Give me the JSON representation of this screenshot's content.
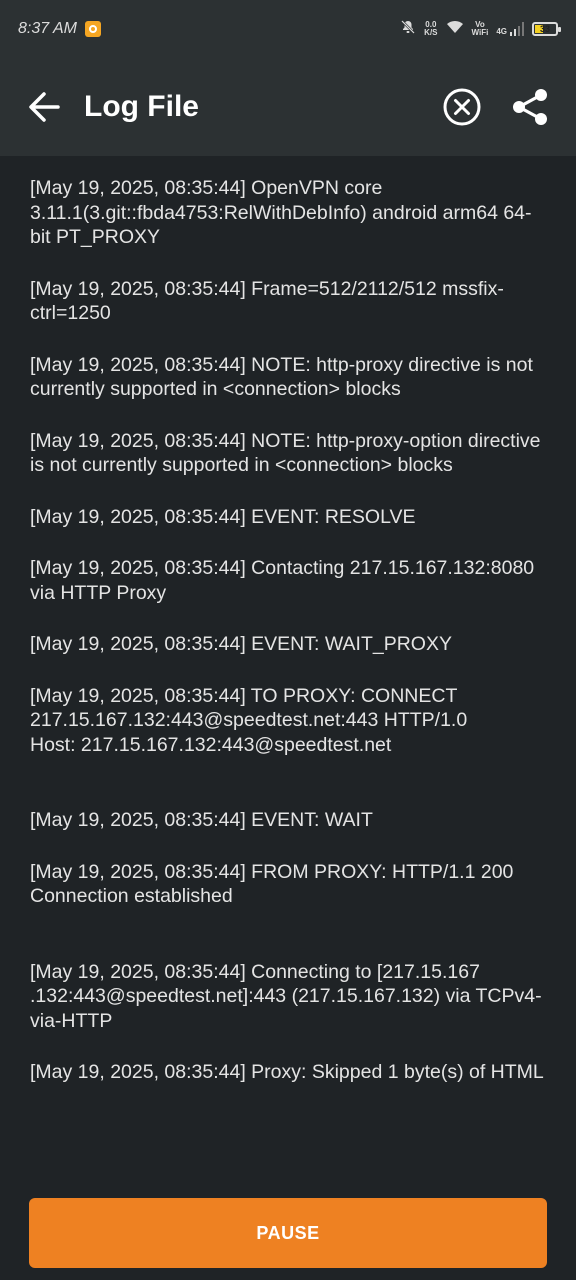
{
  "status_bar": {
    "time": "8:37 AM",
    "net_speed_value": "0.0",
    "net_speed_unit": "K/S",
    "volte_top": "Vo",
    "volte_bottom": "WiFi",
    "network": "4G",
    "battery": "33"
  },
  "header": {
    "title": "Log File",
    "icons": [
      "back-arrow-icon",
      "clear-icon",
      "share-icon"
    ]
  },
  "log": {
    "entries": [
      "[May 19, 2025, 08:35:44] OpenVPN core 3.11.1(3.git::fbda4753:RelWithDebInfo) android arm64 64-bit PT_PROXY",
      "[May 19, 2025, 08:35:44] Frame=512/2112/512 mssfix-ctrl=1250",
      "[May 19, 2025, 08:35:44] NOTE: http-proxy directive is not currently supported in <connection> blocks",
      "[May 19, 2025, 08:35:44] NOTE: http-proxy-option directive is not currently supported in <connection> blocks",
      "[May 19, 2025, 08:35:44] EVENT: RESOLVE",
      "[May 19, 2025, 08:35:44] Contacting 217.15.167.132:8080 via HTTP Proxy",
      "[May 19, 2025, 08:35:44] EVENT: WAIT_PROXY",
      "[May 19, 2025, 08:35:44] TO PROXY: CONNECT 217.15.167.132:443@speedtest.net:443 HTTP/1.0\nHost: 217.15.167.132:443@speedtest.net",
      "[May 19, 2025, 08:35:44] EVENT: WAIT",
      "[May 19, 2025, 08:35:44] FROM PROXY: HTTP/1.1 200 Connection established",
      "[May 19, 2025, 08:35:44] Connecting to [217.15.167 .132:443@speedtest.net]:443 (217.15.167.132) via TCPv4-via-HTTP",
      "[May 19, 2025, 08:35:44] Proxy: Skipped 1 byte(s) of HTML"
    ]
  },
  "footer": {
    "pause_label": "PAUSE"
  },
  "colors": {
    "accent": "#ee8122",
    "background": "#1f2326",
    "app_bar": "#2c3133"
  }
}
